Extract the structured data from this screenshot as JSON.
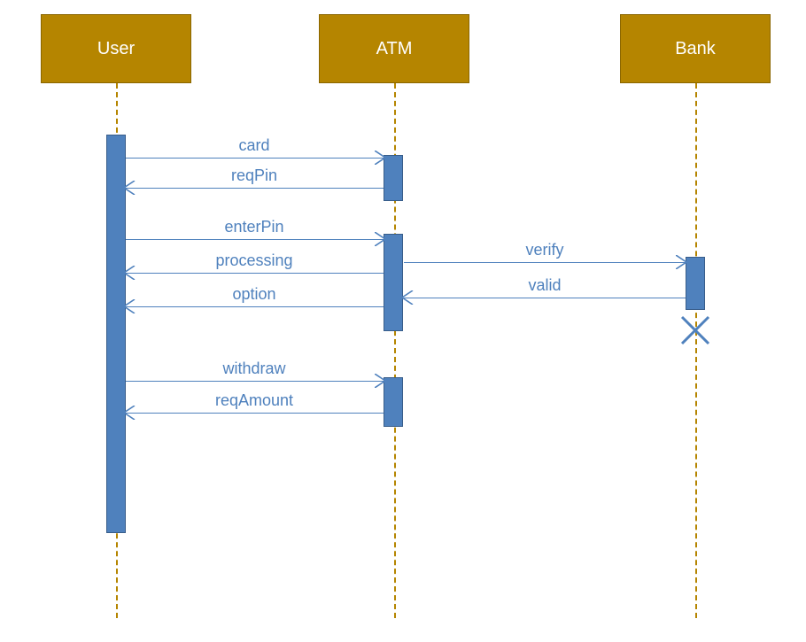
{
  "lifelines": {
    "user": {
      "name": "User"
    },
    "atm": {
      "name": "ATM"
    },
    "bank": {
      "name": "Bank"
    }
  },
  "messages": {
    "m1": "card",
    "m2": "reqPin",
    "m3": "enterPin",
    "m4": "processing",
    "m5": "option",
    "m6": "verify",
    "m7": "valid",
    "m8": "withdraw",
    "m9": "reqAmount"
  },
  "colors": {
    "lifelineBox": "#b58500",
    "activation": "#4f81bd",
    "arrow": "#4f81bd",
    "text": "#4f81bd"
  },
  "diagram_type": "UML sequence diagram"
}
